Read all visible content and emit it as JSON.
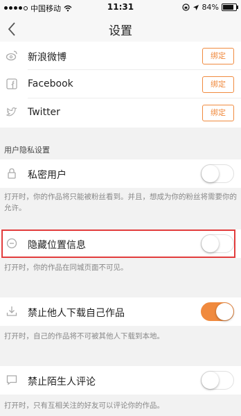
{
  "status_bar": {
    "carrier": "中国移动",
    "time": "11:31",
    "battery": "84%",
    "battery_level": 0.84
  },
  "nav": {
    "title": "设置"
  },
  "social": [
    {
      "name": "新浪微博",
      "icon": "weibo-icon",
      "button": "绑定"
    },
    {
      "name": "Facebook",
      "icon": "facebook-icon",
      "button": "绑定"
    },
    {
      "name": "Twitter",
      "icon": "twitter-icon",
      "button": "绑定"
    }
  ],
  "privacy": {
    "group_title": "用户隐私设置",
    "items": [
      {
        "label": "私密用户",
        "icon": "lock-icon",
        "on": false,
        "desc": "打开时，你的作品将只能被粉丝看到。并且，想成为你的粉丝将需要你的允许。"
      },
      {
        "label": "隐藏位置信息",
        "icon": "location-hide-icon",
        "on": false,
        "desc": "打开时，你的作品在同城页面不可见。"
      },
      {
        "label": "禁止他人下载自己作品",
        "icon": "download-icon",
        "on": true,
        "desc": "打开时，自己的作品将不可被其他人下载到本地。"
      },
      {
        "label": "禁止陌生人评论",
        "icon": "comment-icon",
        "on": false,
        "desc": "打开时，只有互相关注的好友可以评论你的作品。"
      }
    ]
  },
  "colors": {
    "accent": "#f08a3e",
    "highlight": "#e23b3b"
  }
}
